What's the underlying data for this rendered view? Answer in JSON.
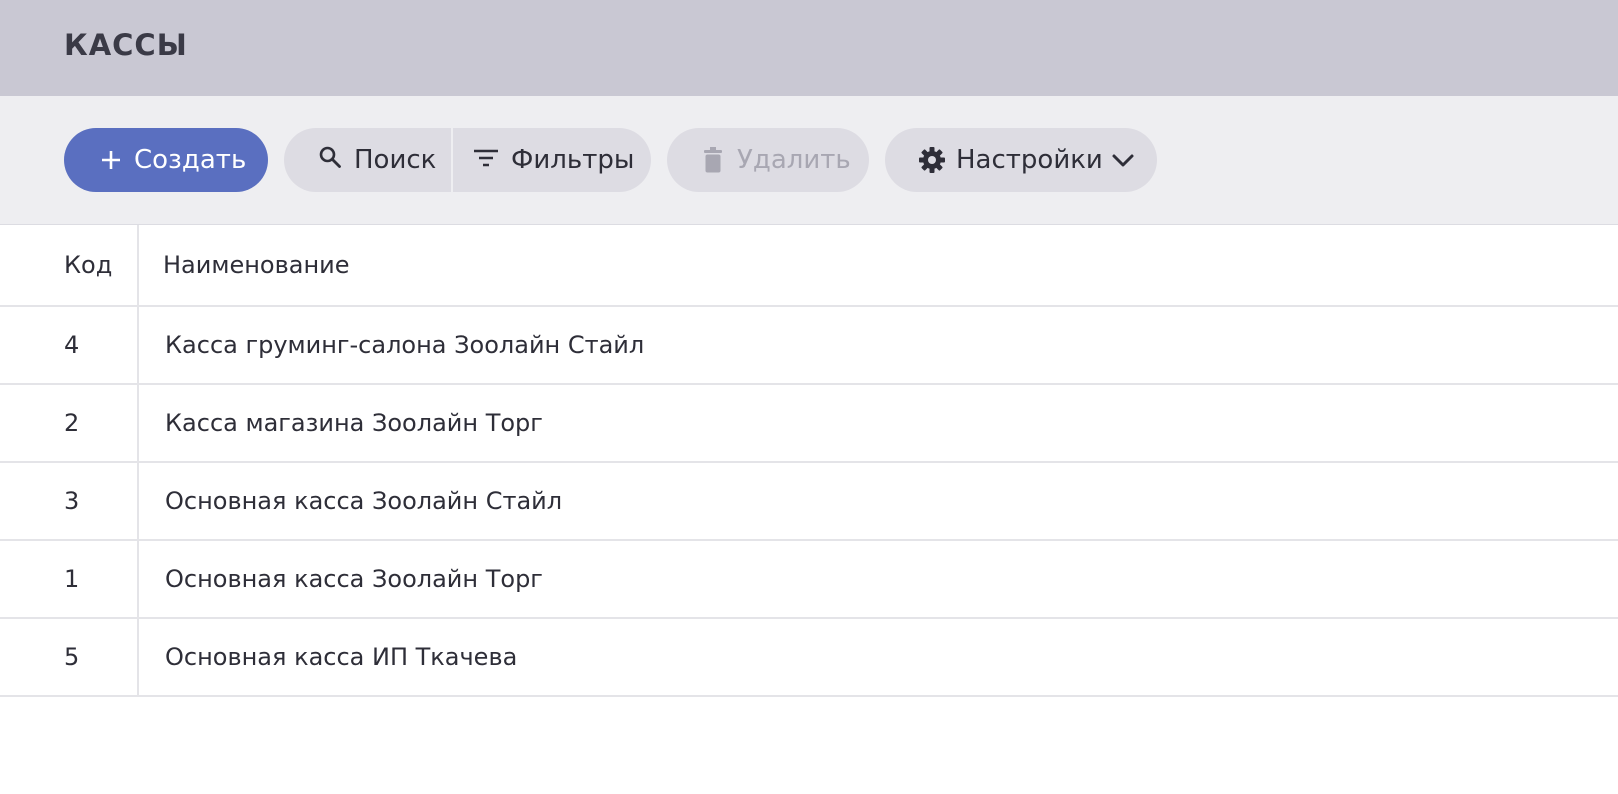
{
  "header": {
    "title": "КАССЫ"
  },
  "toolbar": {
    "create_label": "Создать",
    "search_label": "Поиск",
    "filters_label": "Фильтры",
    "delete_label": "Удалить",
    "settings_label": "Настройки"
  },
  "table": {
    "columns": [
      "Код",
      "Наименование"
    ],
    "rows": [
      {
        "code": "4",
        "name": "Касса груминг-салона Зоолайн Стайл"
      },
      {
        "code": "2",
        "name": "Касса магазина Зоолайн Торг"
      },
      {
        "code": "3",
        "name": "Основная касса Зоолайн Стайл"
      },
      {
        "code": "1",
        "name": "Основная касса Зоолайн Торг"
      },
      {
        "code": "5",
        "name": "Основная касса ИП Ткачева"
      }
    ]
  },
  "icons": {
    "create": "plus-icon",
    "search": "search-icon",
    "filters": "filter-icon",
    "delete": "trash-icon",
    "settings": "gear-icon",
    "settings_menu": "chevron-down-icon"
  },
  "colors": {
    "header_bg": "#c9c8d3",
    "toolbar_bg": "#eeeef1",
    "accent": "#5a6fc0",
    "button_bg": "#dddce3",
    "disabled_text": "#a8a7b2"
  }
}
